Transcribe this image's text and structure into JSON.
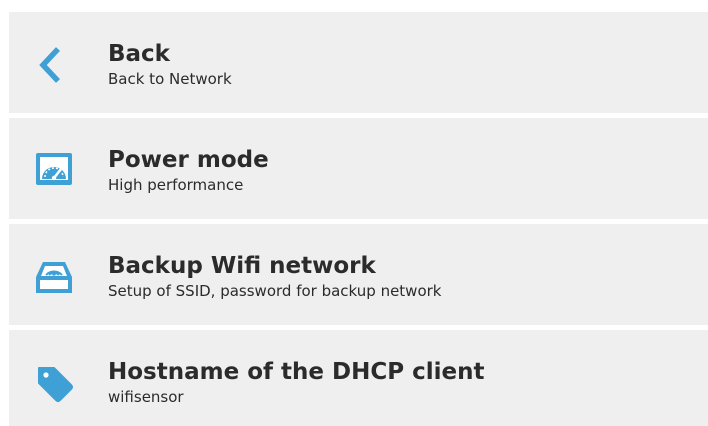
{
  "accent_color": "#3fa0d6",
  "menu": {
    "items": [
      {
        "id": "back",
        "icon": "chevron-left-icon",
        "title": "Back",
        "subtitle": "Back to Network"
      },
      {
        "id": "power-mode",
        "icon": "gauge-icon",
        "title": "Power mode",
        "subtitle": "High performance"
      },
      {
        "id": "backup-wifi",
        "icon": "wifi-tray-icon",
        "title": "Backup Wifi network",
        "subtitle": "Setup of SSID, password for backup network"
      },
      {
        "id": "hostname",
        "icon": "tag-icon",
        "title": "Hostname of the DHCP client",
        "subtitle": "wifisensor"
      }
    ]
  }
}
